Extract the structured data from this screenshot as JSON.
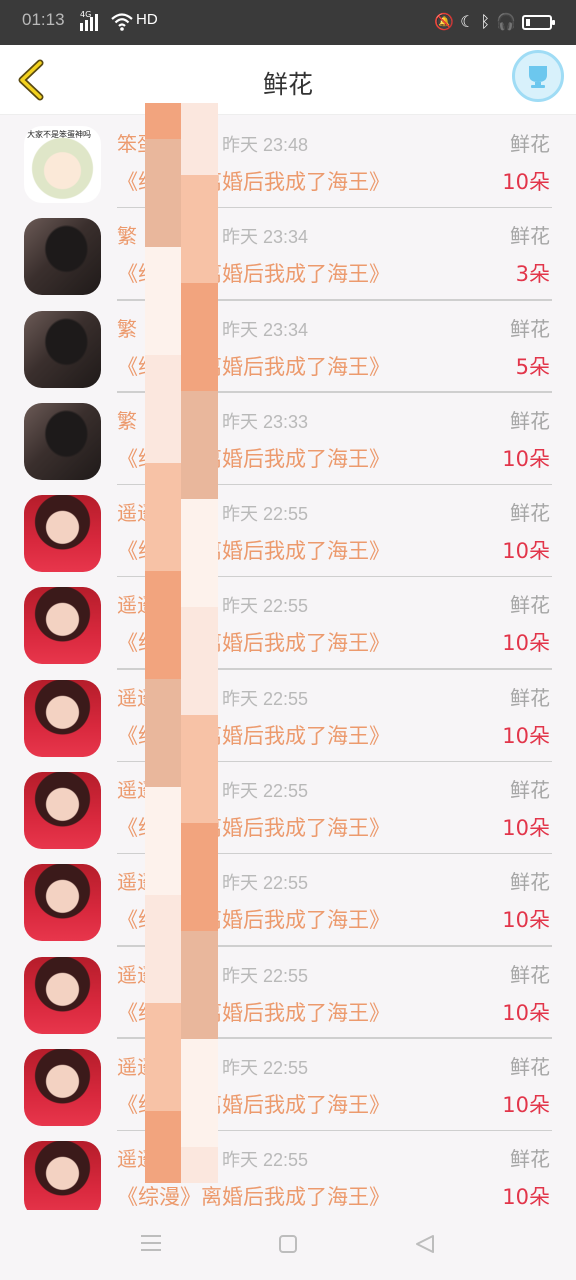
{
  "status_bar": {
    "time": "01:13",
    "network": "4G",
    "hd": "HD"
  },
  "header": {
    "title": "鲜花",
    "back_icon": "chevron-left-icon",
    "action_icon": "cup-icon"
  },
  "records": [
    {
      "name": "笨蛋",
      "time": "昨天 23:48",
      "kind": "鲜花",
      "book": "《综漫》离婚后我成了海王》",
      "count": "10朵",
      "avatar": "anime",
      "caption": "大家不是笨蛋神吗"
    },
    {
      "name": "繁",
      "time": "昨天 23:34",
      "kind": "鲜花",
      "book": "《综漫》离婚后我成了海王》",
      "count": "3朵",
      "avatar": "dark"
    },
    {
      "name": "繁",
      "time": "昨天 23:34",
      "kind": "鲜花",
      "book": "《综漫》离婚后我成了海王》",
      "count": "5朵",
      "avatar": "dark"
    },
    {
      "name": "繁",
      "time": "昨天 23:33",
      "kind": "鲜花",
      "book": "《综漫》离婚后我成了海王》",
      "count": "10朵",
      "avatar": "dark"
    },
    {
      "name": "遥遥",
      "time": "昨天 22:55",
      "kind": "鲜花",
      "book": "《综漫》离婚后我成了海王》",
      "count": "10朵",
      "avatar": "girl"
    },
    {
      "name": "遥遥",
      "time": "昨天 22:55",
      "kind": "鲜花",
      "book": "《综漫》离婚后我成了海王》",
      "count": "10朵",
      "avatar": "girl"
    },
    {
      "name": "遥遥",
      "time": "昨天 22:55",
      "kind": "鲜花",
      "book": "《综漫》离婚后我成了海王》",
      "count": "10朵",
      "avatar": "girl"
    },
    {
      "name": "遥遥",
      "time": "昨天 22:55",
      "kind": "鲜花",
      "book": "《综漫》离婚后我成了海王》",
      "count": "10朵",
      "avatar": "girl"
    },
    {
      "name": "遥遥",
      "time": "昨天 22:55",
      "kind": "鲜花",
      "book": "《综漫》离婚后我成了海王》",
      "count": "10朵",
      "avatar": "girl"
    },
    {
      "name": "遥遥",
      "time": "昨天 22:55",
      "kind": "鲜花",
      "book": "《综漫》离婚后我成了海王》",
      "count": "10朵",
      "avatar": "girl"
    },
    {
      "name": "遥遥",
      "time": "昨天 22:55",
      "kind": "鲜花",
      "book": "《综漫》离婚后我成了海王》",
      "count": "10朵",
      "avatar": "girl"
    },
    {
      "name": "遥遥",
      "time": "昨天 22:55",
      "kind": "鲜花",
      "book": "《综漫》离婚后我成了海王》",
      "count": "10朵",
      "avatar": "girl"
    }
  ],
  "colors": {
    "accent": "#ec9a6d",
    "count": "#e2354a",
    "muted": "#b9b9b9",
    "mosaic": [
      "#f2a47e",
      "#f7c2a6",
      "#fbe7de",
      "#fdf2ec",
      "#e9b79c"
    ]
  },
  "navbar": {
    "icons": [
      "menu-icon",
      "home-icon",
      "back-triangle-icon"
    ]
  }
}
